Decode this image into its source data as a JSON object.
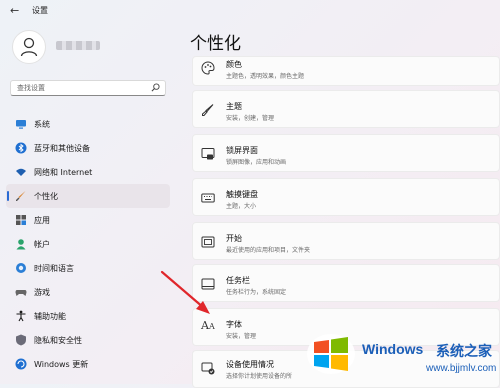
{
  "window": {
    "title": "设置"
  },
  "search": {
    "placeholder": "查找设置"
  },
  "page_title": "个性化",
  "sidebar": {
    "items": [
      {
        "label": "系统",
        "icon": "monitor-icon"
      },
      {
        "label": "蓝牙和其他设备",
        "icon": "bluetooth-icon"
      },
      {
        "label": "网络和 Internet",
        "icon": "wifi-icon"
      },
      {
        "label": "个性化",
        "icon": "brush-icon",
        "active": true
      },
      {
        "label": "应用",
        "icon": "apps-icon"
      },
      {
        "label": "帐户",
        "icon": "account-icon"
      },
      {
        "label": "时间和语言",
        "icon": "globe-clock-icon"
      },
      {
        "label": "游戏",
        "icon": "gamepad-icon"
      },
      {
        "label": "辅助功能",
        "icon": "accessibility-icon"
      },
      {
        "label": "隐私和安全性",
        "icon": "shield-icon"
      },
      {
        "label": "Windows 更新",
        "icon": "update-icon"
      }
    ]
  },
  "cards": [
    {
      "title": "颜色",
      "subtitle": "主题色，透明效果，颜色主题",
      "icon": "palette-icon"
    },
    {
      "title": "主题",
      "subtitle": "安装，创建，管理",
      "icon": "brush-icon"
    },
    {
      "title": "锁屏界面",
      "subtitle": "锁屏图像，应用和动画",
      "icon": "lock-screen-icon"
    },
    {
      "title": "触摸键盘",
      "subtitle": "主题，大小",
      "icon": "keyboard-icon"
    },
    {
      "title": "开始",
      "subtitle": "最近使用的应用和项目，文件夹",
      "icon": "start-icon"
    },
    {
      "title": "任务栏",
      "subtitle": "任务栏行为，系统固定",
      "icon": "taskbar-icon"
    },
    {
      "title": "字体",
      "subtitle": "安装，管理",
      "icon": "font-icon"
    },
    {
      "title": "设备使用情况",
      "subtitle": "选择你计划使用设备的所",
      "icon": "device-usage-icon"
    }
  ],
  "colors": {
    "accent": "#2a6bd4",
    "annotation_arrow": "#e0262b"
  },
  "watermark": {
    "brand": "Windows",
    "cn": "系统之家",
    "url": "www.bjjmlv.com"
  }
}
